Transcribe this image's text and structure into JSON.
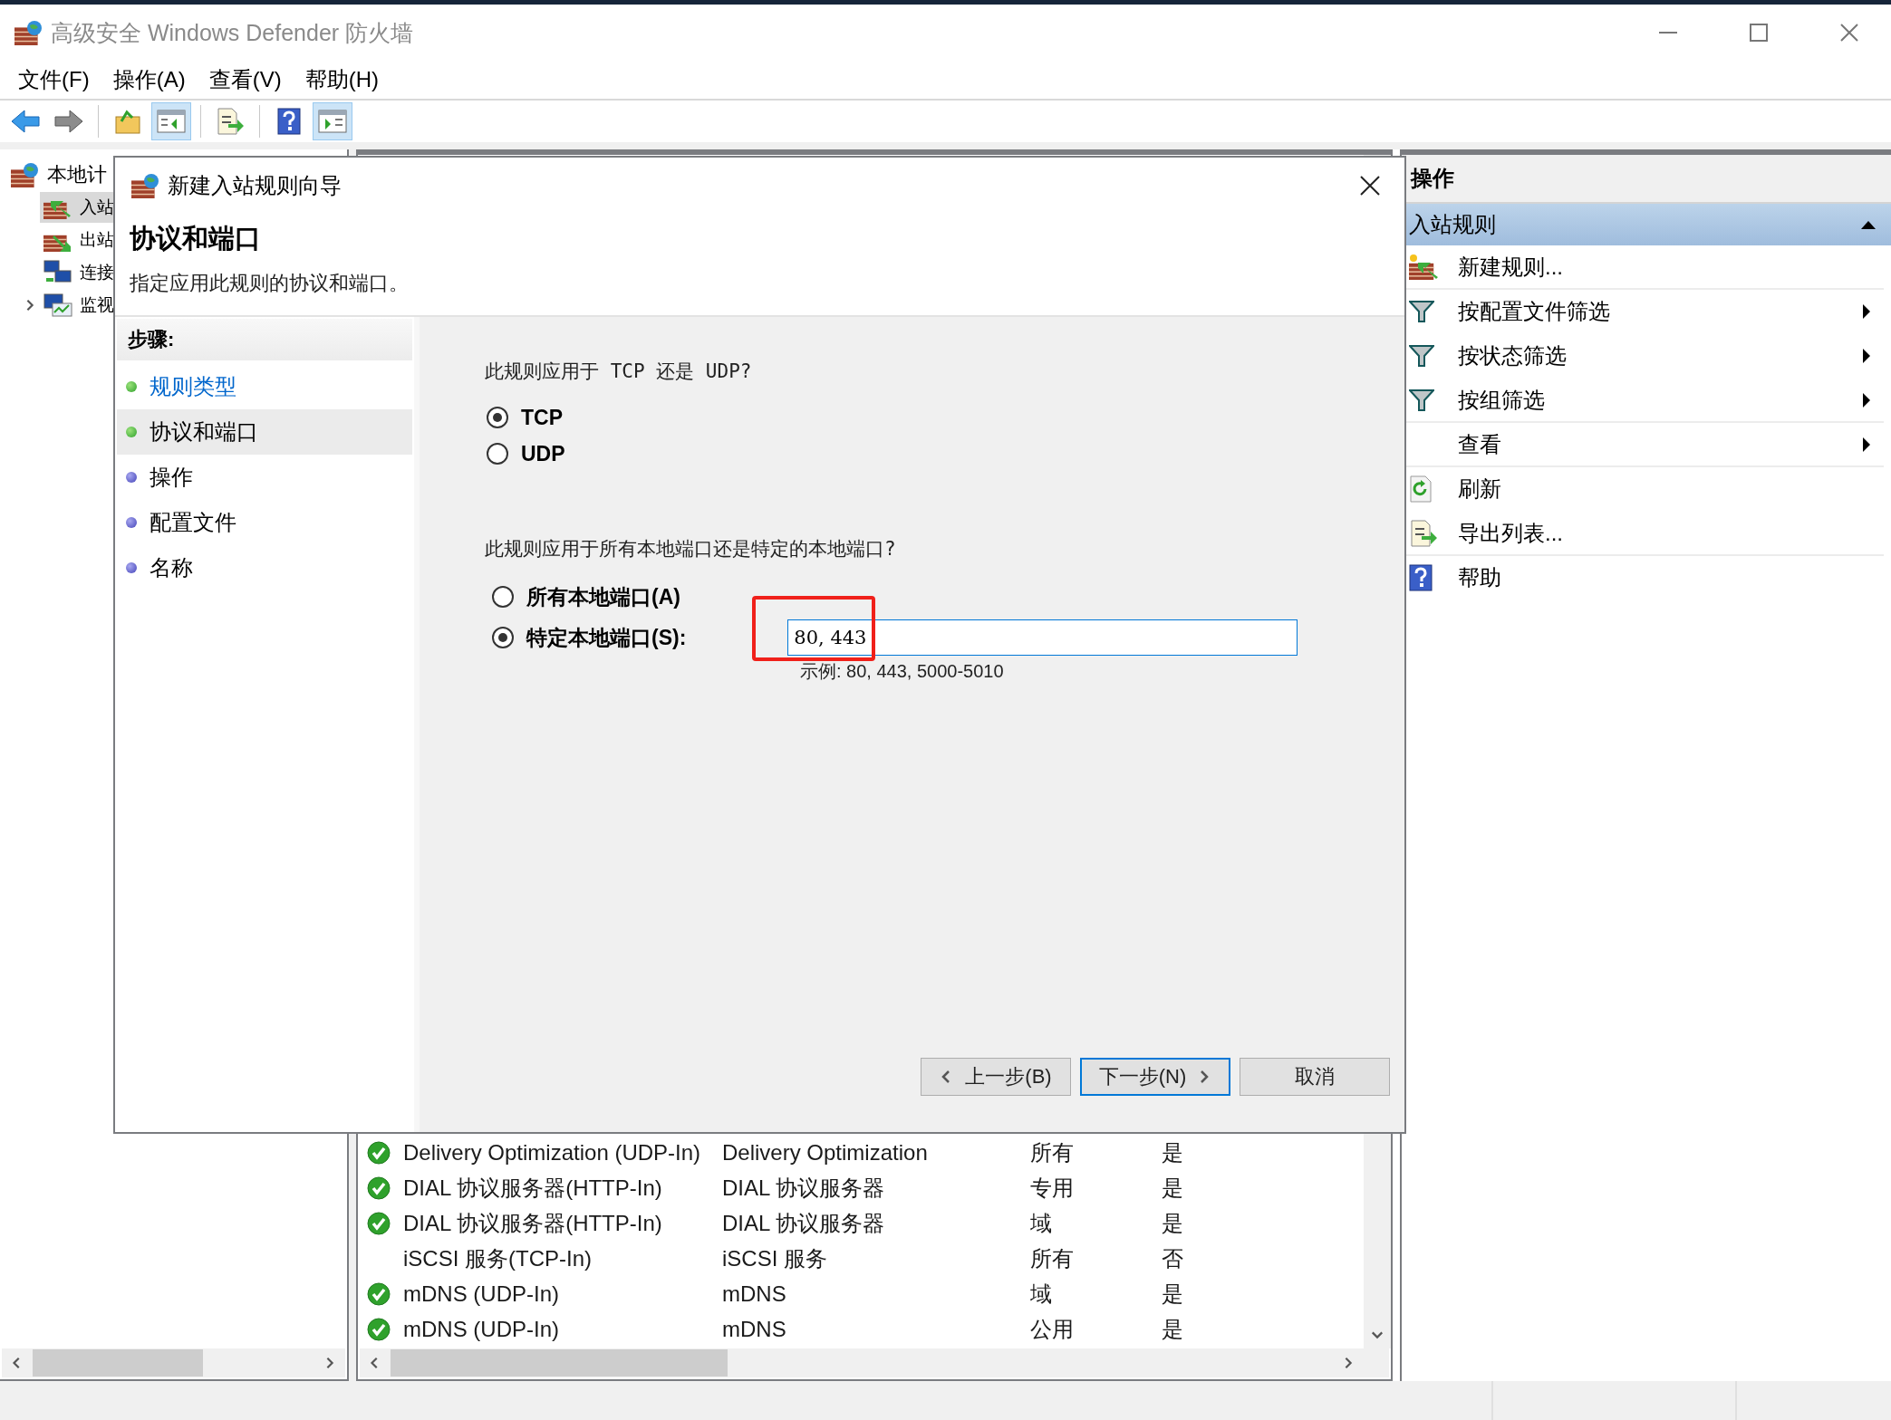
{
  "window": {
    "title": "高级安全 Windows Defender 防火墙"
  },
  "menu": [
    "文件(F)",
    "操作(A)",
    "查看(V)",
    "帮助(H)"
  ],
  "toolbar": [
    [
      {
        "kind": "back",
        "pressed": false
      },
      {
        "kind": "forward",
        "pressed": false
      }
    ],
    [
      {
        "kind": "up",
        "pressed": false
      },
      {
        "kind": "tree",
        "pressed": true
      }
    ],
    [
      {
        "kind": "export",
        "pressed": false
      }
    ],
    [
      {
        "kind": "help",
        "pressed": false
      },
      {
        "kind": "actions",
        "pressed": true
      }
    ]
  ],
  "tree": {
    "label": "本地计",
    "kind": "firewall",
    "children": [
      {
        "label": "入站",
        "kind": "inbound",
        "selected": true,
        "expander": false
      },
      {
        "label": "出站",
        "kind": "outbound",
        "selected": false,
        "expander": false
      },
      {
        "label": "连接",
        "kind": "connection",
        "selected": false,
        "expander": false
      },
      {
        "label": "监视",
        "kind": "monitor",
        "selected": false,
        "expander": true
      }
    ]
  },
  "rules_table": {
    "rows": [
      {
        "name": "Delivery Optimization (UDP-In)",
        "group": "Delivery Optimization",
        "profile": "所有",
        "enabled": "是",
        "active": true
      },
      {
        "name": "DIAL 协议服务器(HTTP-In)",
        "group": "DIAL 协议服务器",
        "profile": "专用",
        "enabled": "是",
        "active": true
      },
      {
        "name": "DIAL 协议服务器(HTTP-In)",
        "group": "DIAL 协议服务器",
        "profile": "域",
        "enabled": "是",
        "active": true
      },
      {
        "name": "iSCSI 服务(TCP-In)",
        "group": "iSCSI 服务",
        "profile": "所有",
        "enabled": "否",
        "active": false
      },
      {
        "name": "mDNS (UDP-In)",
        "group": "mDNS",
        "profile": "域",
        "enabled": "是",
        "active": true
      },
      {
        "name": "mDNS (UDP-In)",
        "group": "mDNS",
        "profile": "公用",
        "enabled": "是",
        "active": true
      }
    ]
  },
  "actions_pane": {
    "title": "操作",
    "section": {
      "label": "入站规则",
      "expanded": true
    },
    "items": [
      {
        "label": "新建规则...",
        "kind": "new_rule",
        "submenu": false,
        "divider_below": true
      },
      {
        "label": "按配置文件筛选",
        "kind": "filter",
        "submenu": true,
        "divider_below": false
      },
      {
        "label": "按状态筛选",
        "kind": "filter",
        "submenu": true,
        "divider_below": false
      },
      {
        "label": "按组筛选",
        "kind": "filter",
        "submenu": true,
        "divider_below": true
      },
      {
        "label": "查看",
        "kind": "none",
        "submenu": true,
        "divider_below": true
      },
      {
        "label": "刷新",
        "kind": "refresh",
        "submenu": false,
        "divider_below": false
      },
      {
        "label": "导出列表...",
        "kind": "export",
        "submenu": false,
        "divider_below": true
      },
      {
        "label": "帮助",
        "kind": "help",
        "submenu": false,
        "divider_below": false
      }
    ]
  },
  "dialog": {
    "title": "新建入站规则向导",
    "heading": "协议和端口",
    "subtitle": "指定应用此规则的协议和端口。",
    "steps_label": "步骤:",
    "steps": [
      {
        "label": "规则类型",
        "done": true,
        "selected": false
      },
      {
        "label": "协议和端口",
        "done": true,
        "selected": true
      },
      {
        "label": "操作",
        "done": false,
        "selected": false
      },
      {
        "label": "配置文件",
        "done": false,
        "selected": false
      },
      {
        "label": "名称",
        "done": false,
        "selected": false
      }
    ],
    "protocol_question": "此规则应用于 TCP 还是 UDP?",
    "protocols": [
      {
        "label": "TCP",
        "selected": true
      },
      {
        "label": "UDP",
        "selected": false
      }
    ],
    "port_question": "此规则应用于所有本地端口还是特定的本地端口?",
    "port_options": [
      {
        "label": "所有本地端口(A)",
        "selected": false
      },
      {
        "label": "特定本地端口(S):",
        "selected": true
      }
    ],
    "port_field": {
      "value": "80, 443"
    },
    "example": "示例: 80, 443, 5000-5010",
    "buttons": [
      {
        "label": "上一步(B)",
        "kind": "back",
        "default": false
      },
      {
        "label": "下一步(N)",
        "kind": "next",
        "default": true
      },
      {
        "label": "取消",
        "kind": "cancel",
        "default": false
      }
    ]
  }
}
